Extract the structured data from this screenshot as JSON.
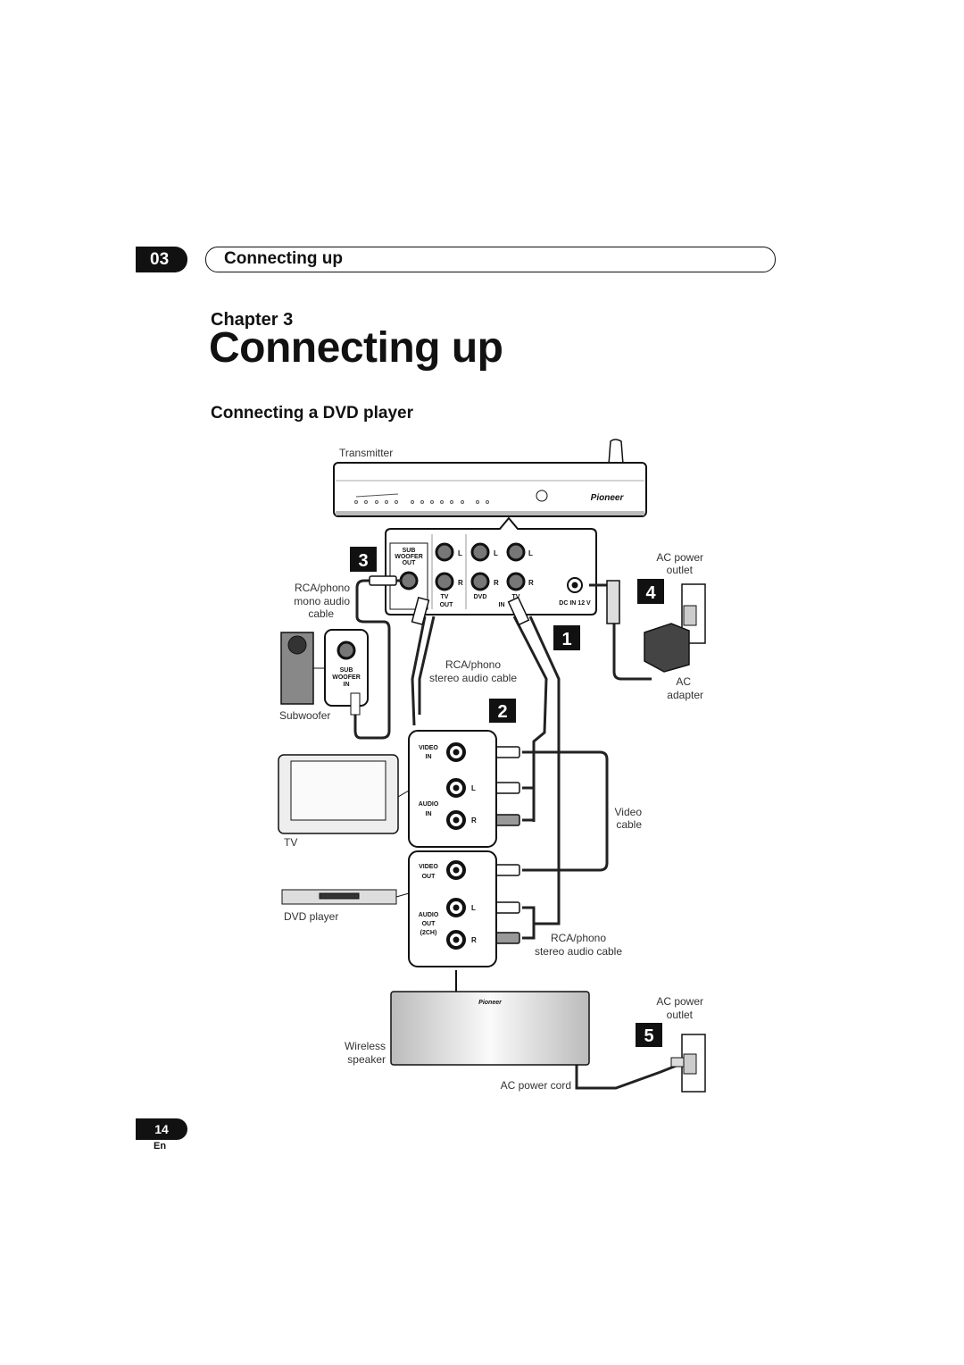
{
  "header": {
    "chapter_number": "03",
    "chapter_title": "Connecting up"
  },
  "chapter_label": "Chapter 3",
  "page_title": "Connecting up",
  "section_title": "Connecting a DVD player",
  "diagram": {
    "transmitter_label": "Transmitter",
    "brand_logo": "Pioneer",
    "step_numbers": [
      "1",
      "2",
      "3",
      "4",
      "5"
    ],
    "transmitter_panel": {
      "sub_woofer_out": [
        "SUB",
        "WOOFER",
        "OUT"
      ],
      "left": "L",
      "right": "R",
      "tv_out": "TV",
      "dvd": "DVD",
      "tv_in": "TV",
      "out": "OUT",
      "in": "IN",
      "dc_in": "DC IN 12 V"
    },
    "subwoofer_panel": [
      "SUB",
      "WOOFER",
      "IN"
    ],
    "tv_panel": {
      "video_in": [
        "VIDEO",
        "IN"
      ],
      "audio_in": [
        "AUDIO",
        "IN"
      ],
      "left": "L",
      "right": "R"
    },
    "dvd_panel": {
      "video_out": [
        "VIDEO",
        "OUT"
      ],
      "audio_out": [
        "AUDIO",
        "OUT",
        "(2CH)"
      ],
      "left": "L",
      "right": "R"
    },
    "labels": {
      "mono_cable": [
        "RCA/phono",
        "mono audio",
        "cable"
      ],
      "subwoofer": "Subwoofer",
      "tv": "TV",
      "dvd_player": "DVD player",
      "wireless_speaker": [
        "Wireless",
        "speaker"
      ],
      "stereo_cable_top": [
        "RCA/phono",
        "stereo audio cable"
      ],
      "ac_outlet_top": [
        "AC power",
        "outlet"
      ],
      "ac_adapter": [
        "AC",
        "adapter"
      ],
      "video_cable": [
        "Video",
        "cable"
      ],
      "stereo_cable_bottom": [
        "RCA/phono",
        "stereo audio cable"
      ],
      "ac_outlet_bottom": [
        "AC power",
        "outlet"
      ],
      "ac_power_cord": "AC  power cord"
    }
  },
  "footer": {
    "page_number": "14",
    "language": "En"
  }
}
